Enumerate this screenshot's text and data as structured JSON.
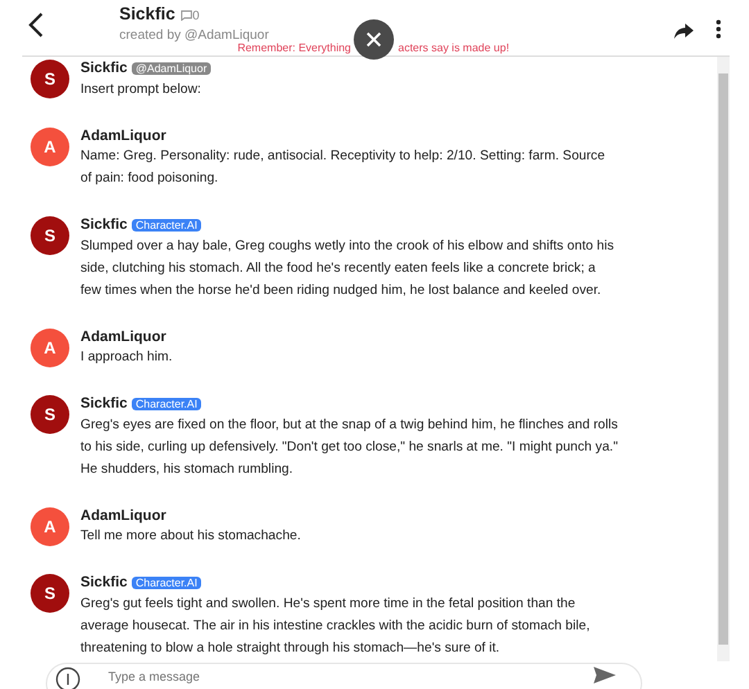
{
  "header": {
    "title": "Sickfic",
    "chat_count": "0",
    "creator": "created by @AdamLiquor"
  },
  "banner": {
    "before": "Remember: Everything",
    "after": "acters say is made up!"
  },
  "messages": [
    {
      "author": "Sickfic",
      "avatar": "S",
      "kind": "bot",
      "tag": "@AdamLiquor",
      "text": "Insert prompt below:"
    },
    {
      "author": "AdamLiquor",
      "avatar": "A",
      "kind": "user",
      "text": "Name: Greg. Personality: rude, antisocial. Receptivity to help: 2/10. Setting: farm. Source of pain: food poisoning."
    },
    {
      "author": "Sickfic",
      "avatar": "S",
      "kind": "bot",
      "tag": "Character.AI",
      "text": "Slumped over a hay bale, Greg coughs wetly into the crook of his elbow and shifts onto his side, clutching his stomach. All the food he's recently eaten feels like a concrete brick; a few times when the horse he'd been riding nudged him, he lost balance and keeled over."
    },
    {
      "author": "AdamLiquor",
      "avatar": "A",
      "kind": "user",
      "text": "I approach him."
    },
    {
      "author": "Sickfic",
      "avatar": "S",
      "kind": "bot",
      "tag": "Character.AI",
      "text": "Greg's eyes are fixed on the floor, but at the snap of a twig behind him, he flinches and rolls to his side, curling up defensively. \"Don't get too close,\" he snarls at me. \"I might punch ya.\" He shudders, his stomach rumbling."
    },
    {
      "author": "AdamLiquor",
      "avatar": "A",
      "kind": "user",
      "text": "Tell me more about his stomachache."
    },
    {
      "author": "Sickfic",
      "avatar": "S",
      "kind": "bot",
      "tag": "Character.AI",
      "text": "Greg's gut feels tight and swollen. He's spent more time in the fetal position than the average housecat. The air in his intestine crackles with the acidic burn of stomach bile, threatening to blow a hole straight through his stomach—he's sure of it."
    }
  ],
  "composer": {
    "placeholder": "Type a message"
  }
}
